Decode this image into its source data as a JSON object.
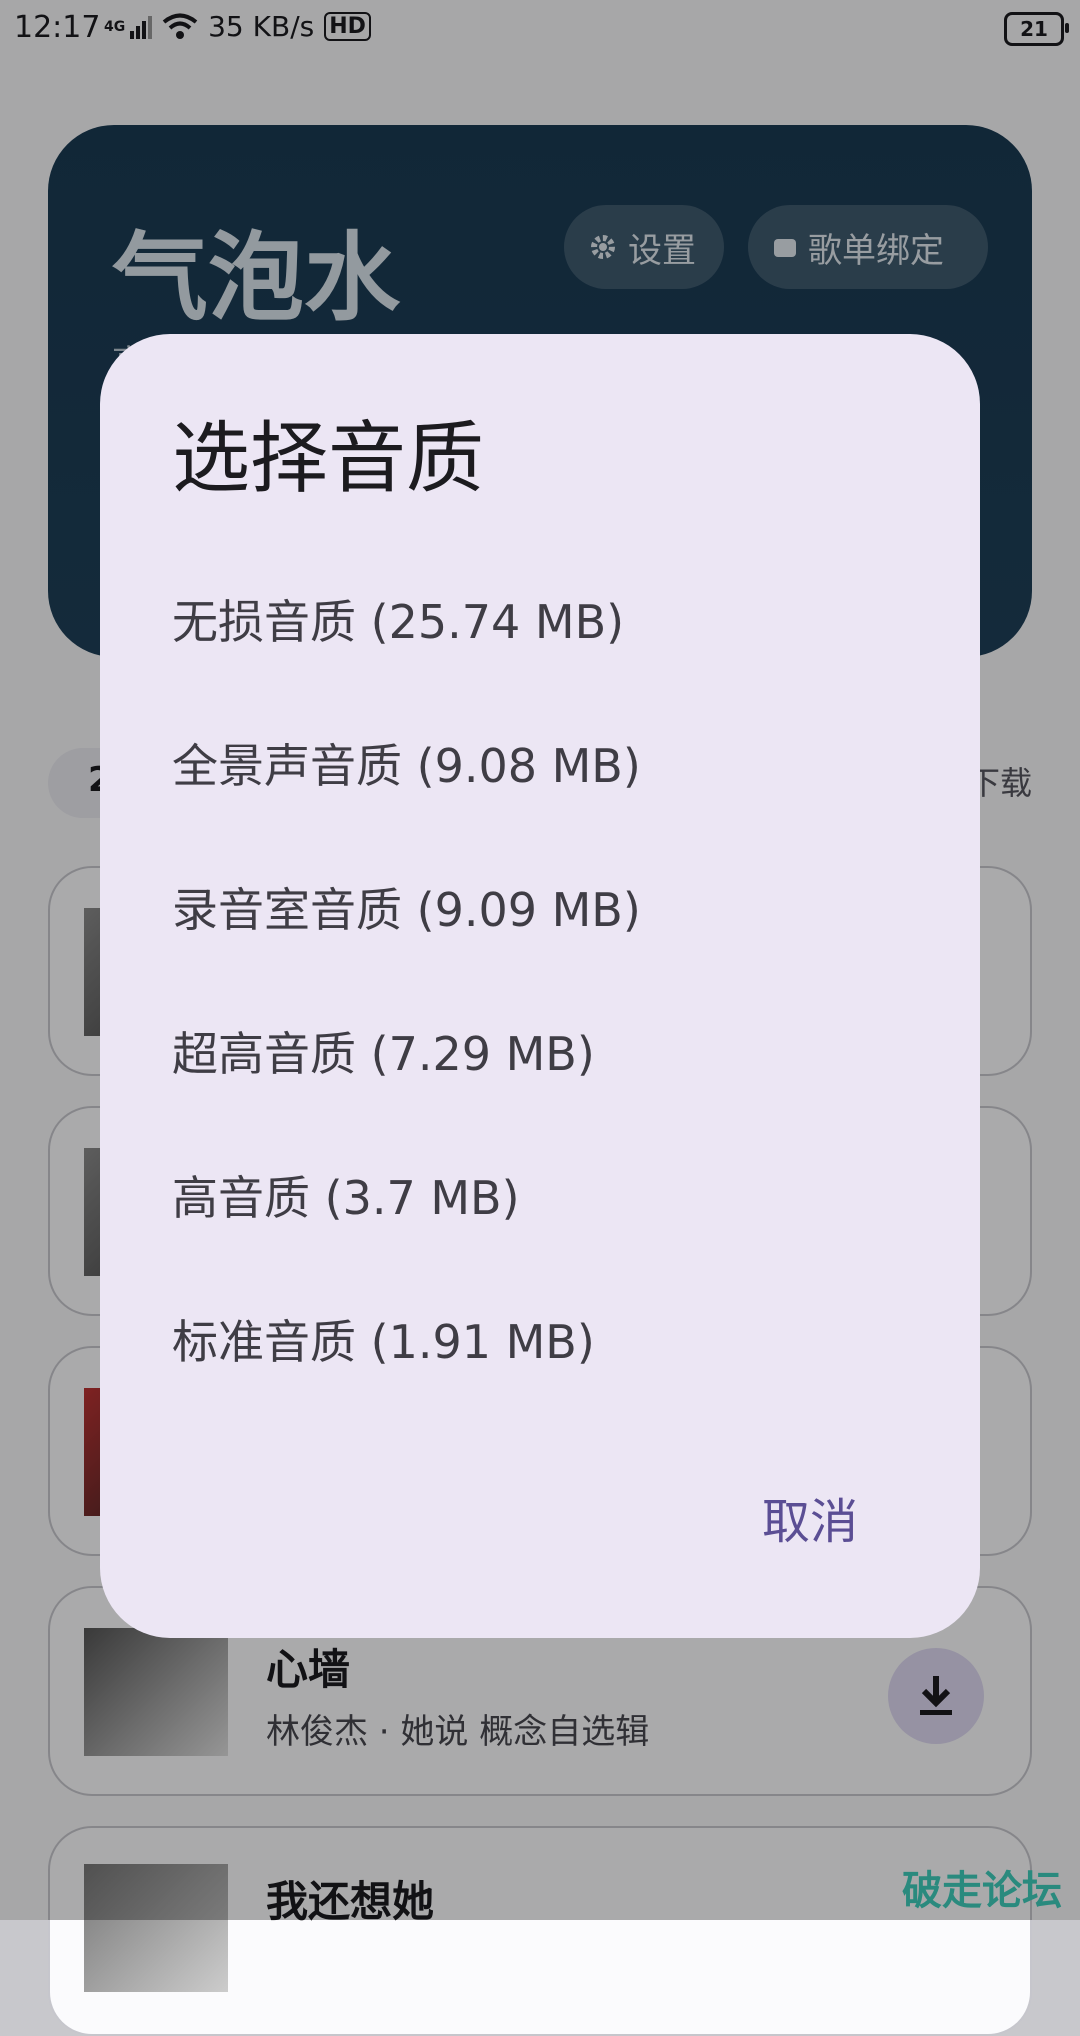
{
  "status_bar": {
    "time": "12:17",
    "network": "4G",
    "speed": "35 KB/s",
    "battery": "21",
    "hd": "HD"
  },
  "header": {
    "title": "气泡水",
    "subtitle": "高",
    "settings_label": "设置",
    "playlist_bind_label": "歌单绑定"
  },
  "list": {
    "count_label": "2",
    "download_all": "下载"
  },
  "songs": [
    {
      "title": "心墙",
      "subtitle": "林俊杰 · 她说 概念自选辑"
    },
    {
      "title": "我还想她",
      "subtitle": ""
    }
  ],
  "dialog": {
    "title": "选择音质",
    "options": [
      "无损音质 (25.74 MB)",
      "全景声音质 (9.08 MB)",
      "录音室音质 (9.09 MB)",
      "超高音质 (7.29 MB)",
      "高音质 (3.7 MB)",
      "标准音质 (1.91 MB)"
    ],
    "cancel_label": "取消"
  },
  "watermark": "破走论坛"
}
